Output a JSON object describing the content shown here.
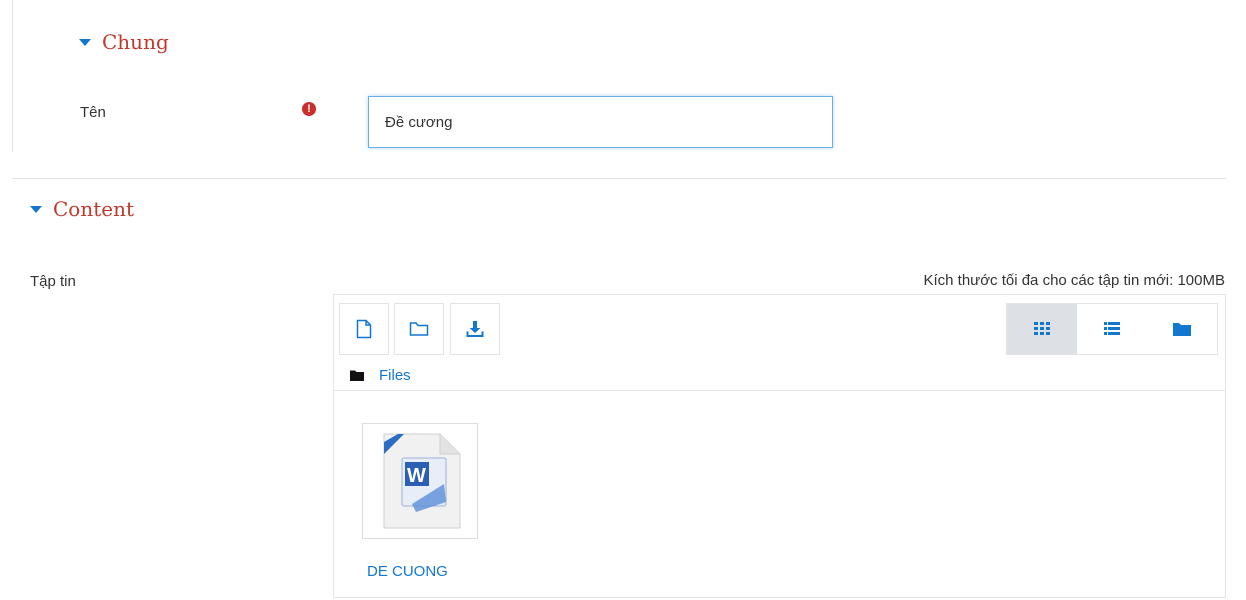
{
  "general": {
    "title": "Chung"
  },
  "name_field": {
    "label": "Tên",
    "value": "Đề cương"
  },
  "content": {
    "title": "Content"
  },
  "file_field": {
    "label": "Tập tin",
    "max_size": "Kích thước tối đa cho các tập tin mới: 100MB"
  },
  "filepicker": {
    "breadcrumb": "Files",
    "active_view": "icons",
    "files": [
      {
        "name": "DE CUONG",
        "type": "word-document"
      }
    ]
  },
  "colors": {
    "accent": "#1177d1",
    "section_title": "#c0392b",
    "required": "#c9302c",
    "active_view_bg": "#dde1e5"
  }
}
